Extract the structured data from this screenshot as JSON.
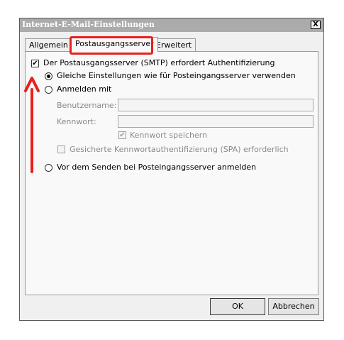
{
  "dialog": {
    "title": "Internet-E-Mail-Einstellungen",
    "close_label": "X"
  },
  "tabs": [
    {
      "label": "Allgemein"
    },
    {
      "label": "Postausgangsserver"
    },
    {
      "label": "Erweitert"
    }
  ],
  "smtp_auth": {
    "label": "Der Postausgangsserver (SMTP) erfordert Authentifizierung",
    "checked": true
  },
  "options": {
    "same_settings": "Gleiche Einstellungen wie für Posteingangsserver verwenden",
    "login_with": "Anmelden mit",
    "username_label": "Benutzername:",
    "username_value": "",
    "password_label": "Kennwort:",
    "password_value": "",
    "save_password": "Kennwort speichern",
    "spa": "Gesicherte Kennwortauthentifizierung (SPA) erforderlich",
    "login_before_send": "Vor dem Senden bei Posteingangsserver anmelden"
  },
  "buttons": {
    "ok": "OK",
    "cancel": "Abbrechen"
  },
  "annotation": {
    "color": "#e8211f"
  }
}
